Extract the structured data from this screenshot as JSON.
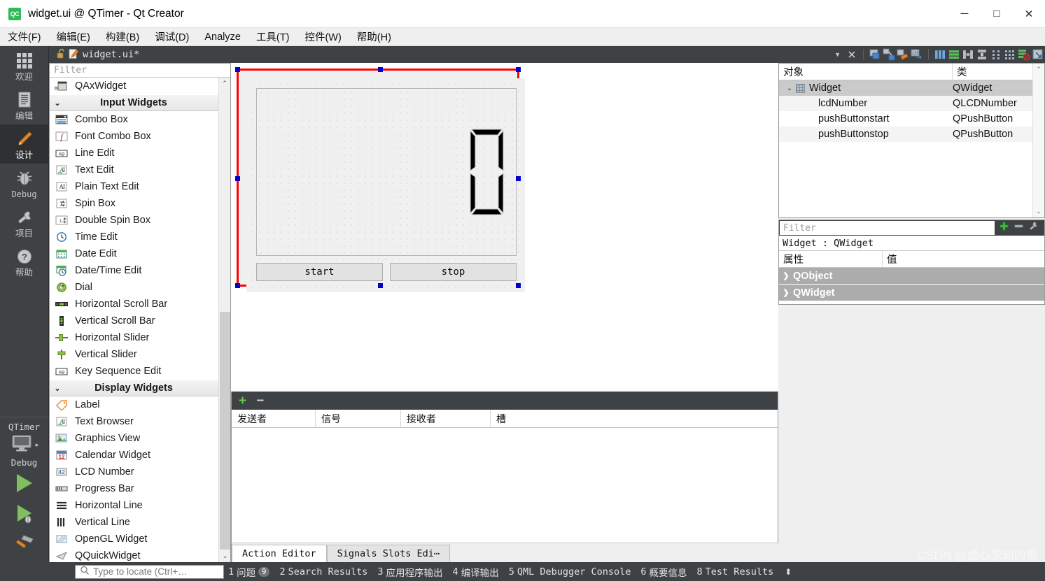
{
  "window": {
    "title": "widget.ui @ QTimer - Qt Creator",
    "logo_text": "QC",
    "minimize": "─",
    "maximize": "□",
    "close": "✕"
  },
  "menubar": {
    "items": [
      {
        "label": "文件(F)",
        "mnemonic": "F"
      },
      {
        "label": "编辑(E)",
        "mnemonic": "E"
      },
      {
        "label": "构建(B)",
        "mnemonic": "B"
      },
      {
        "label": "调试(D)",
        "mnemonic": "D"
      },
      {
        "label": "Analyze",
        "mnemonic": "A"
      },
      {
        "label": "工具(T)",
        "mnemonic": "T"
      },
      {
        "label": "控件(W)",
        "mnemonic": "W"
      },
      {
        "label": "帮助(H)",
        "mnemonic": "H"
      }
    ]
  },
  "modebar": {
    "items": [
      {
        "label": "欢迎",
        "icon": "grid-icon",
        "active": false
      },
      {
        "label": "编辑",
        "icon": "document-icon",
        "active": false
      },
      {
        "label": "设计",
        "icon": "pencil-icon",
        "active": true
      },
      {
        "label": "Debug",
        "icon": "bug-icon",
        "active": false
      },
      {
        "label": "项目",
        "icon": "wrench-icon",
        "active": false
      },
      {
        "label": "帮助",
        "icon": "question-icon",
        "active": false
      }
    ],
    "kit_name": "QTimer",
    "build_config": "Debug",
    "run_button": "run-icon",
    "debug_button": "run-debug-icon",
    "build_button": "hammer-icon"
  },
  "editor_toolbar": {
    "filename": "widget.ui*",
    "lock_icon": "unlocked-icon",
    "file_icon": "edit-file-icon",
    "dropdown_icon": "chevron-down-icon",
    "close_icon": "close-icon",
    "tools": [
      "edit-widgets-icon",
      "edit-signals-slots-icon",
      "edit-buddies-icon",
      "edit-tab-order-icon",
      "layout-horizontally-icon",
      "layout-vertically-icon",
      "layout-splitter-h-icon",
      "layout-splitter-v-icon",
      "layout-form-icon",
      "layout-grid-icon",
      "break-layout-icon",
      "adjust-size-icon"
    ]
  },
  "widgetbox": {
    "filter_placeholder": "Filter",
    "rows": [
      {
        "type": "item",
        "label": "QAxWidget",
        "icon": "axwidget-icon"
      },
      {
        "type": "category",
        "label": "Input Widgets",
        "icon": "chevron-down-icon"
      },
      {
        "type": "item",
        "label": "Combo Box",
        "icon": "combobox-icon"
      },
      {
        "type": "item",
        "label": "Font Combo Box",
        "icon": "fontcombobox-icon"
      },
      {
        "type": "item",
        "label": "Line Edit",
        "icon": "lineedit-icon"
      },
      {
        "type": "item",
        "label": "Text Edit",
        "icon": "textedit-icon"
      },
      {
        "type": "item",
        "label": "Plain Text Edit",
        "icon": "plaintextedit-icon"
      },
      {
        "type": "item",
        "label": "Spin Box",
        "icon": "spinbox-icon"
      },
      {
        "type": "item",
        "label": "Double Spin Box",
        "icon": "doublespinbox-icon"
      },
      {
        "type": "item",
        "label": "Time Edit",
        "icon": "timeedit-icon"
      },
      {
        "type": "item",
        "label": "Date Edit",
        "icon": "dateedit-icon"
      },
      {
        "type": "item",
        "label": "Date/Time Edit",
        "icon": "datetimeedit-icon"
      },
      {
        "type": "item",
        "label": "Dial",
        "icon": "dial-icon"
      },
      {
        "type": "item",
        "label": "Horizontal Scroll Bar",
        "icon": "hscrollbar-icon"
      },
      {
        "type": "item",
        "label": "Vertical Scroll Bar",
        "icon": "vscrollbar-icon"
      },
      {
        "type": "item",
        "label": "Horizontal Slider",
        "icon": "hslider-icon"
      },
      {
        "type": "item",
        "label": "Vertical Slider",
        "icon": "vslider-icon"
      },
      {
        "type": "item",
        "label": "Key Sequence Edit",
        "icon": "keysequenceedit-icon"
      },
      {
        "type": "category",
        "label": "Display Widgets",
        "icon": "chevron-down-icon"
      },
      {
        "type": "item",
        "label": "Label",
        "icon": "label-icon"
      },
      {
        "type": "item",
        "label": "Text Browser",
        "icon": "textbrowser-icon"
      },
      {
        "type": "item",
        "label": "Graphics View",
        "icon": "graphicsview-icon"
      },
      {
        "type": "item",
        "label": "Calendar Widget",
        "icon": "calendar-icon"
      },
      {
        "type": "item",
        "label": "LCD Number",
        "icon": "lcdnumber-icon"
      },
      {
        "type": "item",
        "label": "Progress Bar",
        "icon": "progressbar-icon"
      },
      {
        "type": "item",
        "label": "Horizontal Line",
        "icon": "hline-icon"
      },
      {
        "type": "item",
        "label": "Vertical Line",
        "icon": "vline-icon"
      },
      {
        "type": "item",
        "label": "OpenGL Widget",
        "icon": "opengl-icon"
      },
      {
        "type": "item",
        "label": "QQuickWidget",
        "icon": "qquickwidget-icon"
      }
    ]
  },
  "form": {
    "lcd_value": "0",
    "buttons": [
      {
        "label": "start",
        "object": "pushButtonstart"
      },
      {
        "label": "stop",
        "object": "pushButtonstop"
      }
    ],
    "selection_color": "#ff0000",
    "handle_color": "#0000cc"
  },
  "signal_slot_editor": {
    "add_icon": "plus-icon",
    "remove_icon": "minus-icon",
    "columns": [
      "发送者",
      "信号",
      "接收者",
      "槽"
    ],
    "rows": [],
    "tabs": [
      {
        "label": "Action Editor",
        "active": true
      },
      {
        "label": "Signals  Slots Edi⋯",
        "active": false
      }
    ]
  },
  "object_tree": {
    "columns": [
      "对象",
      "类"
    ],
    "rows": [
      {
        "name": "Widget",
        "class": "QWidget",
        "depth": 0,
        "selected": true,
        "expandable": true,
        "expand_icon": "chevron-down-icon",
        "icon": "widget-icon"
      },
      {
        "name": "lcdNumber",
        "class": "QLCDNumber",
        "depth": 1,
        "selected": false,
        "expandable": false
      },
      {
        "name": "pushButtonstart",
        "class": "QPushButton",
        "depth": 1,
        "selected": false,
        "expandable": false
      },
      {
        "name": "pushButtonstop",
        "class": "QPushButton",
        "depth": 1,
        "selected": false,
        "expandable": false
      }
    ]
  },
  "property_editor": {
    "filter_placeholder": "Filter",
    "add_icon": "plus-icon",
    "remove_icon": "minus-icon",
    "config_icon": "wrench-icon",
    "object_header": "Widget : QWidget",
    "columns": [
      "属性",
      "值"
    ],
    "groups": [
      {
        "label": "QObject",
        "expand_icon": "chevron-right-icon"
      },
      {
        "label": "QWidget",
        "expand_icon": "chevron-right-icon"
      }
    ]
  },
  "statusbar": {
    "locator_placeholder": "Type to locate (Ctrl+…",
    "locator_icon": "search-icon",
    "items": [
      {
        "num": "1",
        "label": "问题",
        "badge": "9"
      },
      {
        "num": "2",
        "label": "Search Results",
        "badge": ""
      },
      {
        "num": "3",
        "label": "应用程序输出",
        "badge": ""
      },
      {
        "num": "4",
        "label": "编译输出",
        "badge": ""
      },
      {
        "num": "5",
        "label": "QML Debugger Console",
        "badge": ""
      },
      {
        "num": "6",
        "label": "概要信息",
        "badge": ""
      },
      {
        "num": "8",
        "label": "Test Results",
        "badge": ""
      }
    ],
    "updown_icon": "up-down-icon",
    "watermark": "CSDN @虚心求知的熊"
  }
}
